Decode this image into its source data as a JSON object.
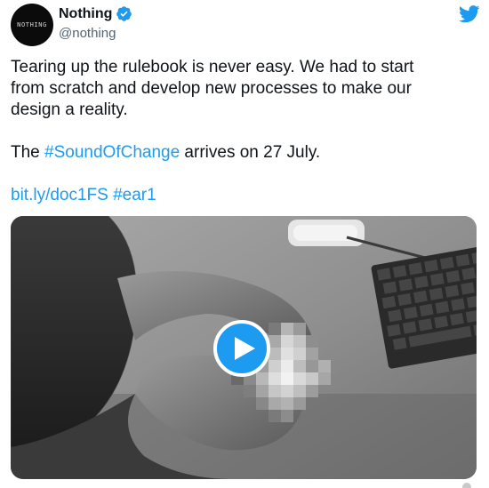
{
  "account": {
    "avatar_text": "NOTHING",
    "display_name": "Nothing",
    "handle": "@nothing",
    "verified": true
  },
  "icons": {
    "verified": "verified-badge-icon",
    "brand": "twitter-bird-icon",
    "play": "play-icon"
  },
  "tweet": {
    "line1": "Tearing up the rulebook is never easy. We had to start",
    "line2": "from scratch and develop new processes to make our",
    "line3": "design a reality.",
    "p2_prefix": "The ",
    "hashtag": "#SoundOfChange",
    "p2_suffix": " arrives on 27 July.",
    "link": "bit.ly/doc1FS",
    "hashtag2": "#ear1"
  },
  "colors": {
    "accent": "#1d9bf0",
    "text": "#0f1419",
    "muted": "#536471"
  }
}
